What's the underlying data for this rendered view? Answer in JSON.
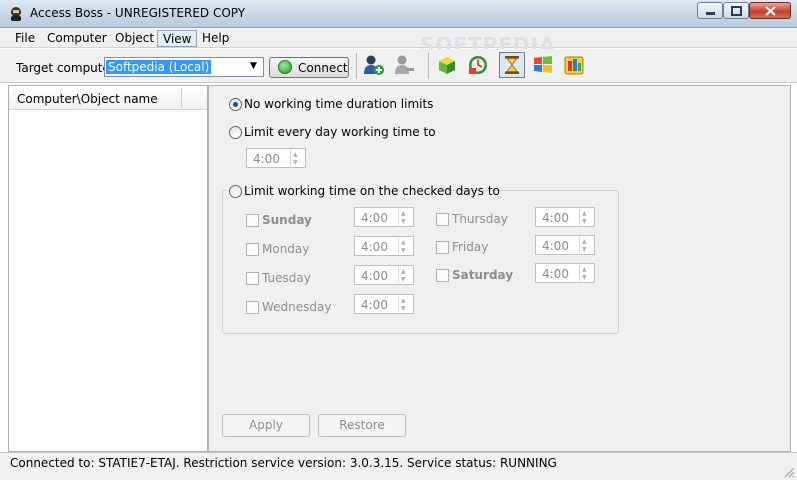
{
  "window": {
    "title": "Access Boss - UNREGISTERED COPY",
    "watermark": "SOFTPEDIA"
  },
  "menu": {
    "file": "File",
    "computer": "Computer",
    "object": "Object",
    "view": "View",
    "help": "Help"
  },
  "toolbar": {
    "target_label": "Target computer",
    "target_value": "Softpedia (Local)",
    "connect_label": "Connect",
    "icons": [
      "add-user-icon",
      "remove-user-icon",
      "program-icon",
      "internet-schedule-icon",
      "hourglass-icon",
      "windows-icon",
      "apps-icon"
    ]
  },
  "left_panel": {
    "column_header": "Computer\\Object name"
  },
  "options": {
    "no_limits": "No working time duration limits",
    "every_day": "Limit every day working time to",
    "every_day_value": "4:00",
    "checked_days": "Limit working time on the checked days to",
    "selected": "no_limits"
  },
  "days": {
    "sunday": {
      "label": "Sunday",
      "value": "4:00"
    },
    "monday": {
      "label": "Monday",
      "value": "4:00"
    },
    "tuesday": {
      "label": "Tuesday",
      "value": "4:00"
    },
    "wednesday": {
      "label": "Wednesday",
      "value": "4:00"
    },
    "thursday": {
      "label": "Thursday",
      "value": "4:00"
    },
    "friday": {
      "label": "Friday",
      "value": "4:00"
    },
    "saturday": {
      "label": "Saturday",
      "value": "4:00"
    }
  },
  "buttons": {
    "apply": "Apply",
    "restore": "Restore"
  },
  "status": {
    "text": "Connected to: STATIE7-ETAJ.  Restriction service version: 3.0.3.15.  Service status: RUNNING"
  },
  "colors": {
    "selection": "#3399ff",
    "connect_green": "#25a025",
    "disabled_text": "#8d8d8d"
  }
}
